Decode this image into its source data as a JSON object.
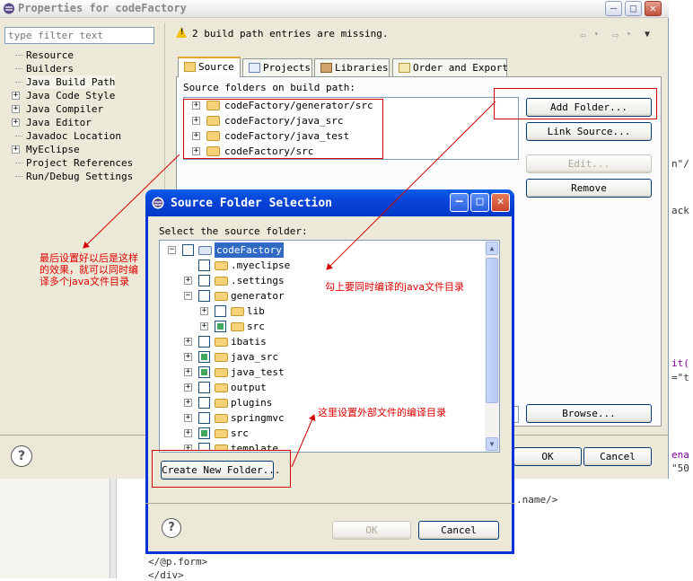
{
  "background_editor": {
    "fragments": [
      "n\"/",
      "ack",
      "it(",
      "=\"t",
      "ena",
      "\"50",
      ".name/>",
      "</@p.form>",
      "</div>"
    ]
  },
  "properties_dialog": {
    "title": "Properties for codeFactory",
    "filter_placeholder": "type filter text",
    "nav_items": [
      {
        "label": "Resource",
        "expandable": false
      },
      {
        "label": "Builders",
        "expandable": false
      },
      {
        "label": "Java Build Path",
        "expandable": false,
        "selected": true
      },
      {
        "label": "Java Code Style",
        "expandable": true
      },
      {
        "label": "Java Compiler",
        "expandable": true
      },
      {
        "label": "Java Editor",
        "expandable": true
      },
      {
        "label": "Javadoc Location",
        "expandable": false
      },
      {
        "label": "MyEclipse",
        "expandable": true
      },
      {
        "label": "Project References",
        "expandable": false
      },
      {
        "label": "Run/Debug Settings",
        "expandable": false
      }
    ],
    "warning_message": "2 build path entries are missing.",
    "tabs": [
      {
        "label": "Source",
        "active": true
      },
      {
        "label": "Projects",
        "active": false
      },
      {
        "label": "Libraries",
        "active": false
      },
      {
        "label": "Order and Export",
        "active": false
      }
    ],
    "source_folders_label": "Source folders on build path:",
    "source_folders": [
      "codeFactory/generator/src",
      "codeFactory/java_src",
      "codeFactory/java_test",
      "codeFactory/src"
    ],
    "buttons": {
      "add_folder": "Add Folder...",
      "link_source": "Link Source...",
      "edit": "Edit...",
      "remove": "Remove",
      "browse": "Browse...",
      "ok": "OK",
      "cancel": "Cancel"
    }
  },
  "source_folder_dialog": {
    "title": "Source Folder Selection",
    "prompt": "Select the source folder:",
    "tree": [
      {
        "label": "codeFactory",
        "indent": 0,
        "expander": "minus",
        "checked": false,
        "project": true,
        "selected": true
      },
      {
        "label": ".myeclipse",
        "indent": 1,
        "expander": "none",
        "checked": false
      },
      {
        "label": ".settings",
        "indent": 1,
        "expander": "plus",
        "checked": false
      },
      {
        "label": "generator",
        "indent": 1,
        "expander": "minus",
        "checked": false
      },
      {
        "label": "lib",
        "indent": 2,
        "expander": "plus",
        "checked": false
      },
      {
        "label": "src",
        "indent": 2,
        "expander": "plus",
        "checked": true
      },
      {
        "label": "ibatis",
        "indent": 1,
        "expander": "plus",
        "checked": false
      },
      {
        "label": "java_src",
        "indent": 1,
        "expander": "plus",
        "checked": true
      },
      {
        "label": "java_test",
        "indent": 1,
        "expander": "plus",
        "checked": true
      },
      {
        "label": "output",
        "indent": 1,
        "expander": "plus",
        "checked": false
      },
      {
        "label": "plugins",
        "indent": 1,
        "expander": "plus",
        "checked": false
      },
      {
        "label": "springmvc",
        "indent": 1,
        "expander": "plus",
        "checked": false
      },
      {
        "label": "src",
        "indent": 1,
        "expander": "plus",
        "checked": true
      },
      {
        "label": "template",
        "indent": 1,
        "expander": "plus",
        "checked": false
      }
    ],
    "buttons": {
      "create_new_folder": "Create New Folder...",
      "ok": "OK",
      "cancel": "Cancel"
    }
  },
  "annotations": {
    "note_left": "最后设置好以后是这样的效果，就可以同时编译多个java文件目录",
    "note_check": "勾上要同时编译的java文件目录",
    "note_external": "这里设置外部文件的编译目录"
  },
  "colors": {
    "annotation_red": "#d40000",
    "xp_title_blue": "#0844d8",
    "selection_blue": "#316ac5",
    "dialog_beige": "#ece9d8"
  }
}
